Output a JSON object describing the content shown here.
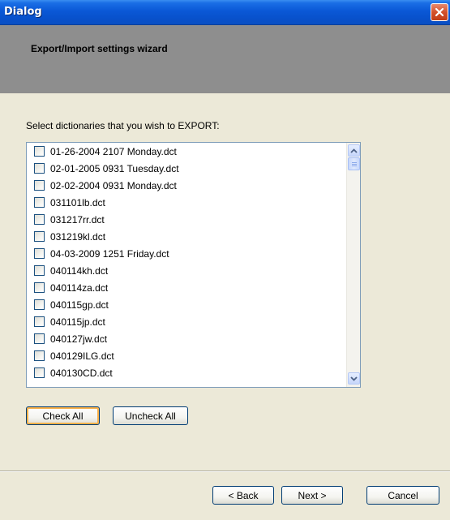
{
  "window": {
    "title": "Dialog"
  },
  "header": {
    "title": "Export/Import settings wizard"
  },
  "prompt": "Select dictionaries that you wish to EXPORT:",
  "dictionaries": [
    "01-26-2004 2107 Monday.dct",
    "02-01-2005 0931 Tuesday.dct",
    "02-02-2004 0931 Monday.dct",
    "031101lb.dct",
    "031217rr.dct",
    "031219kl.dct",
    "04-03-2009 1251 Friday.dct",
    "040114kh.dct",
    "040114za.dct",
    "040115gp.dct",
    "040115jp.dct",
    "040127jw.dct",
    "040129ILG.dct",
    "040130CD.dct"
  ],
  "buttons": {
    "check_all": "Check All",
    "uncheck_all": "Uncheck All",
    "back": "< Back",
    "next": "Next >",
    "cancel": "Cancel"
  },
  "icons": {
    "close": "close-icon",
    "scroll_up": "chevron-up-icon",
    "scroll_down": "chevron-down-icon"
  },
  "colors": {
    "titlebar": "#0a58d6",
    "header_panel": "#8e8e8e",
    "dialog_bg": "#ece9d8",
    "close_button": "#d3512c",
    "focus_ring": "#f9b14a"
  }
}
